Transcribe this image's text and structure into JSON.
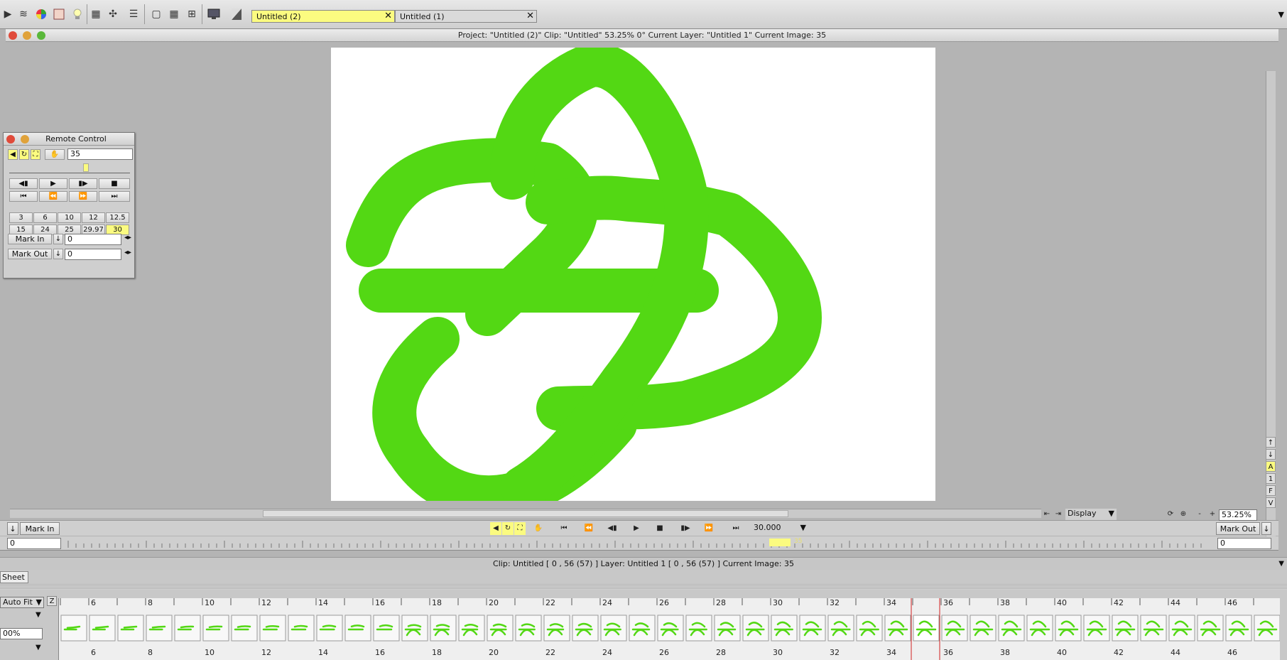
{
  "toolbar": {
    "tabs": [
      {
        "label": "Untitled (2)",
        "active": true
      },
      {
        "label": "Untitled (1)",
        "active": false
      }
    ],
    "tab_close_glyph": "✕",
    "tools": [
      "play-icon",
      "layers-icon",
      "color-wheel-icon",
      "swatch-icon",
      "bulb-icon",
      "grid-icon",
      "transform-icon",
      "stack-icon",
      "light-table-icon",
      "grid-large-icon",
      "grid-split-icon",
      "monitor-icon",
      "gradient-icon"
    ]
  },
  "viewer": {
    "title": "Project:  \"Untitled (2)\"  Clip: \"Untitled\"   53.25%   0°   Current Layer: \"Untitled 1\"   Current Image: 35",
    "canvas_bg": "#ffffff",
    "stroke_color": "#53d814",
    "side_buttons": [
      "A",
      "1",
      "F",
      "V"
    ],
    "mark_in_label": "Mark In",
    "mark_out_label": "Mark Out",
    "fps_value": "30.000",
    "display_label": "Display",
    "zoom_value": "53.25%",
    "mark_in_field": "0",
    "mark_out_field": "0",
    "timeline_current": "35"
  },
  "remote": {
    "title": "Remote Control",
    "frame_value": "35",
    "fps_presets_row1": [
      "3",
      "6",
      "10",
      "12",
      "12.5"
    ],
    "fps_presets_row2": [
      "15",
      "24",
      "25",
      "29.97",
      "30"
    ],
    "active_fps": "30",
    "mark_in_label": "Mark In",
    "mark_out_label": "Mark Out",
    "mark_in_value": "0",
    "mark_out_value": "0"
  },
  "status": {
    "text": "Clip: Untitled [ 0 , 56  (57) ]      Layer: Untitled 1 [ 0 , 56  (57) ]    Current Image: 35"
  },
  "xsheet": {
    "tab_label": "Sheet",
    "fit_label": "Auto Fit",
    "zoom_label": "00%",
    "z_label": "Z",
    "frame_labels": [
      "6",
      "8",
      "10",
      "12",
      "14",
      "16",
      "18",
      "20",
      "22",
      "24",
      "26",
      "28",
      "30",
      "32",
      "34",
      "36",
      "38",
      "40",
      "42",
      "44",
      "46"
    ],
    "current_frame": 35
  }
}
